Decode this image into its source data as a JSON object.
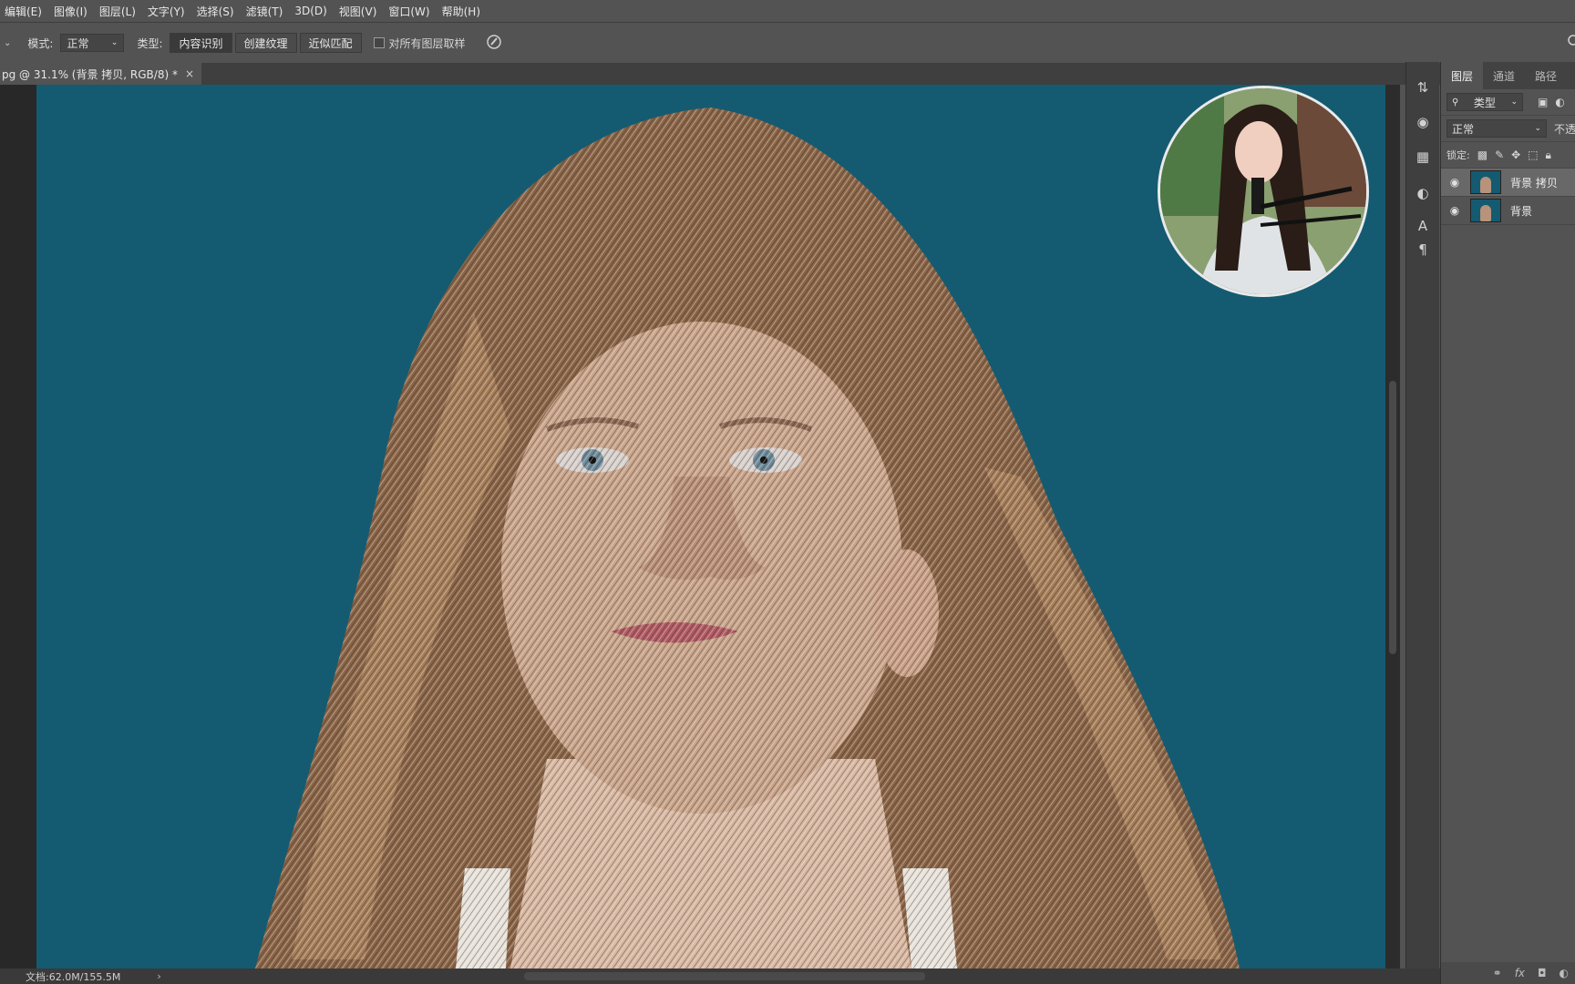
{
  "menu": [
    "编辑(E)",
    "图像(I)",
    "图层(L)",
    "文字(Y)",
    "选择(S)",
    "滤镜(T)",
    "3D(D)",
    "视图(V)",
    "窗口(W)",
    "帮助(H)"
  ],
  "options": {
    "mode_label": "模式:",
    "mode_value": "正常",
    "type_label": "类型:",
    "type_buttons": [
      "内容识别",
      "创建纹理",
      "近似匹配"
    ],
    "sample_all_label": "对所有图层取样"
  },
  "document_tab": {
    "title": "pg @ 31.1% (背景 拷贝, RGB/8) *",
    "close": "×"
  },
  "status": {
    "doc_size": "文档:62.0M/155.5M",
    "arrow": "›"
  },
  "layers_panel": {
    "tabs": [
      "图层",
      "通道",
      "路径"
    ],
    "filter_kind": "类型",
    "blend_mode": "正常",
    "opacity_label": "不透",
    "lock_label": "锁定:",
    "layers": [
      {
        "name": "背景 拷贝",
        "visible": true,
        "selected": true
      },
      {
        "name": "背景",
        "visible": true,
        "selected": false
      }
    ],
    "bottom_icons": [
      "link-icon",
      "fx-icon",
      "mask-icon",
      "adjustment-icon"
    ],
    "fx_text": "fx"
  },
  "colors": {
    "canvas_background": "#145b71",
    "ui_gray": "#535353",
    "skin": "#c9a48a",
    "hair": "#8a6446"
  }
}
